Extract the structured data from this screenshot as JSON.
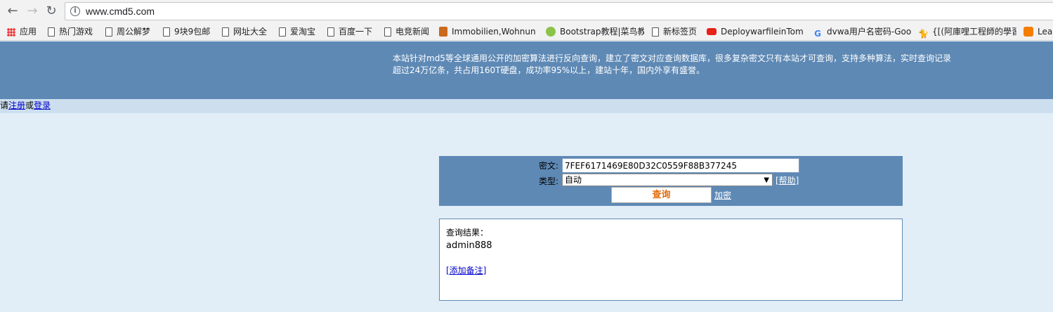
{
  "browser": {
    "url": "www.cmd5.com",
    "bookmarks": [
      {
        "label": "应用",
        "icon": "apps-grid-icon"
      },
      {
        "label": "热门游戏",
        "icon": "document-icon"
      },
      {
        "label": "周公解梦",
        "icon": "document-icon"
      },
      {
        "label": "9块9包邮",
        "icon": "document-icon"
      },
      {
        "label": "网址大全",
        "icon": "document-icon"
      },
      {
        "label": "爱淘宝",
        "icon": "document-icon"
      },
      {
        "label": "百度一下",
        "icon": "document-icon"
      },
      {
        "label": "电竞新闻",
        "icon": "document-icon"
      },
      {
        "label": "Immobilien,Wohnun",
        "icon": "house-icon"
      },
      {
        "label": "Bootstrap教程|菜鸟教",
        "icon": "runoob-icon"
      },
      {
        "label": "新标签页",
        "icon": "document-icon"
      },
      {
        "label": "DeploywarfileinTom",
        "icon": "youtube-icon"
      },
      {
        "label": "dvwa用户名密码-Goo",
        "icon": "google-icon"
      },
      {
        "label": "{[(阿庫哩工程師的學習",
        "icon": "github-cat-icon"
      },
      {
        "label": "Lear",
        "icon": "blogger-icon"
      }
    ]
  },
  "banner": {
    "line1": "本站针对md5等全球通用公开的加密算法进行反向查询，建立了密文对应查询数据库，很多复杂密文只有本站才可查询，支持多种算法，实时查询记录",
    "line2": "超过24万亿条，共占用160T硬盘，成功率95%以上，建站十年，国内外享有盛誉。"
  },
  "login": {
    "prefix": "请",
    "register": "注册",
    "or": "或",
    "login": "登录"
  },
  "query": {
    "cipher_label": "密文:",
    "cipher_value": "7FEF6171469E80D32C0559F88B377245",
    "type_label": "类型:",
    "type_selected": "自动",
    "help_link": "[帮助]",
    "submit_label": "查询",
    "encrypt_link": "加密"
  },
  "result": {
    "label": "查询结果：",
    "value": "admin888",
    "add_note": "[添加备注]"
  },
  "colors": {
    "banner": "#5e89b5",
    "page_bg": "#e1eef7",
    "query_button_text": "#e46c0a",
    "link": "#0000cc"
  }
}
